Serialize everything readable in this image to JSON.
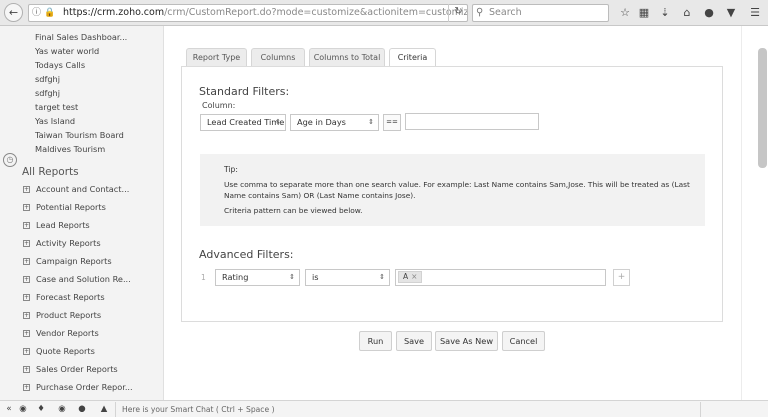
{
  "browser": {
    "back_icon": "back-arrow-icon",
    "url_secure": "https://crm.",
    "url_domain": "zoho.com",
    "url_path": "/crm/CustomReport.do?mode=customize&actionitem=customize&reportId",
    "search_placeholder": "Search"
  },
  "sidebar": {
    "recent_items": [
      "Final Sales Dashboar...",
      "Yas water world",
      "Todays Calls",
      "sdfghj",
      "sdfghj",
      "target test",
      "Yas Island",
      "Taiwan Tourism Board",
      "Maldives Tourism"
    ],
    "all_reports_label": "All Reports",
    "folders": [
      "Account and Contact...",
      "Potential Reports",
      "Lead Reports",
      "Activity Reports",
      "Campaign Reports",
      "Case and Solution Re...",
      "Forecast Reports",
      "Product Reports",
      "Vendor Reports",
      "Quote Reports",
      "Sales Order Reports",
      "Purchase Order Repor..."
    ]
  },
  "tabs": [
    "Report Type",
    "Columns",
    "Columns to Total",
    "Criteria"
  ],
  "standard_filters": {
    "title": "Standard Filters:",
    "column_label": "Column:",
    "column_select": "Lead Created Time",
    "type_select": "Age in Days",
    "operator": "=="
  },
  "tip": {
    "title": "Tip:",
    "body": "Use comma to separate more than one search value. For example: Last Name contains Sam,Jose. This will be treated as (Last Name contains Sam) OR (Last Name contains Jose).",
    "note": "Criteria pattern can be viewed below."
  },
  "advanced_filters": {
    "title": "Advanced Filters:",
    "row_number": "1",
    "field_select": "Rating",
    "operator_select": "is",
    "value_chip": "A",
    "chip_remove": "×",
    "add_icon": "+"
  },
  "buttons": {
    "run": "Run",
    "save": "Save",
    "save_as_new": "Save As New",
    "cancel": "Cancel"
  },
  "bottombar": {
    "chat_placeholder": "Here is your Smart Chat ( Ctrl + Space )"
  }
}
